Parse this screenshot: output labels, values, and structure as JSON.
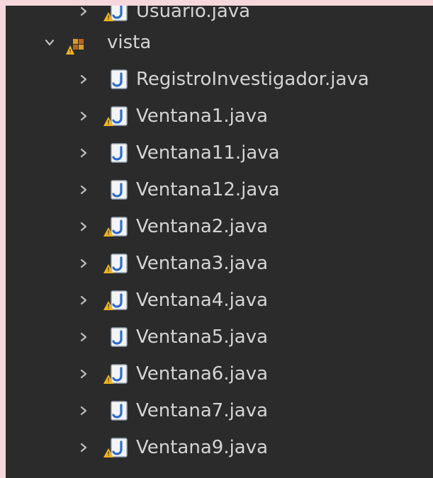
{
  "tree": {
    "top_item": {
      "label": "Usuario.java"
    },
    "folder": {
      "label": "vista"
    },
    "items": [
      {
        "label": "RegistroInvestigador.java",
        "warning": false
      },
      {
        "label": "Ventana1.java",
        "warning": true
      },
      {
        "label": "Ventana11.java",
        "warning": false
      },
      {
        "label": "Ventana12.java",
        "warning": false
      },
      {
        "label": "Ventana2.java",
        "warning": true
      },
      {
        "label": "Ventana3.java",
        "warning": true
      },
      {
        "label": "Ventana4.java",
        "warning": true
      },
      {
        "label": "Ventana5.java",
        "warning": false
      },
      {
        "label": "Ventana6.java",
        "warning": true
      },
      {
        "label": "Ventana7.java",
        "warning": false
      },
      {
        "label": "Ventana9.java",
        "warning": true
      }
    ]
  },
  "colors": {
    "background": "#2b2b2b",
    "frame": "#f6d7dc",
    "text": "#d4d4d4",
    "chevron": "#bdbdbd",
    "java_blue": "#2f6cc9",
    "java_face": "#f4f4f4",
    "warning": "#f0b323"
  },
  "icons": {
    "folder": "package-warning-icon",
    "file": "java-file-icon",
    "warning": "warning-icon",
    "chevron_right": "chevron-right-icon",
    "chevron_down": "chevron-down-icon"
  }
}
